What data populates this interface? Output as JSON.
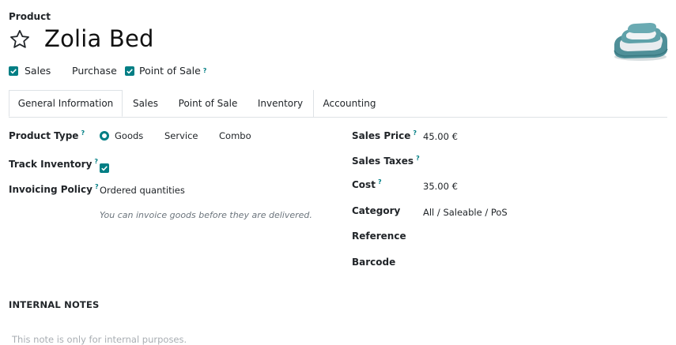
{
  "header": {
    "breadcrumb": "Product",
    "product_name": "Zolia Bed",
    "product_image_alt": "Zolia Bed"
  },
  "flags": [
    {
      "label": "Sales",
      "checked": true
    },
    {
      "label": "Purchase",
      "checked": false
    },
    {
      "label": "Point of Sale",
      "checked": true,
      "help": "?"
    }
  ],
  "tabs": [
    {
      "label": "General Information",
      "active": true
    },
    {
      "label": "Sales"
    },
    {
      "label": "Point of Sale"
    },
    {
      "label": "Inventory"
    },
    {
      "label": "Accounting"
    }
  ],
  "left": {
    "product_type": {
      "label": "Product Type",
      "help": "?",
      "options": [
        "Goods",
        "Service",
        "Combo"
      ],
      "selected": "Goods"
    },
    "track_inventory": {
      "label": "Track Inventory",
      "help": "?",
      "checked": true
    },
    "invoicing_policy": {
      "label": "Invoicing Policy",
      "help": "?",
      "value": "Ordered quantities",
      "hint": "You can invoice goods before they are delivered."
    }
  },
  "right": {
    "sales_price": {
      "label": "Sales Price",
      "help": "?",
      "value": "45.00 €"
    },
    "sales_taxes": {
      "label": "Sales Taxes",
      "help": "?",
      "value": ""
    },
    "cost": {
      "label": "Cost",
      "help": "?",
      "value": "35.00 €"
    },
    "category": {
      "label": "Category",
      "value": "All / Saleable / PoS"
    },
    "reference": {
      "label": "Reference",
      "value": ""
    },
    "barcode": {
      "label": "Barcode",
      "value": ""
    }
  },
  "notes": {
    "title": "INTERNAL NOTES",
    "placeholder": "This note is only for internal purposes."
  },
  "colors": {
    "accent": "#017e84",
    "text": "#212529",
    "muted": "#6c757d",
    "border": "#dee2e6"
  }
}
